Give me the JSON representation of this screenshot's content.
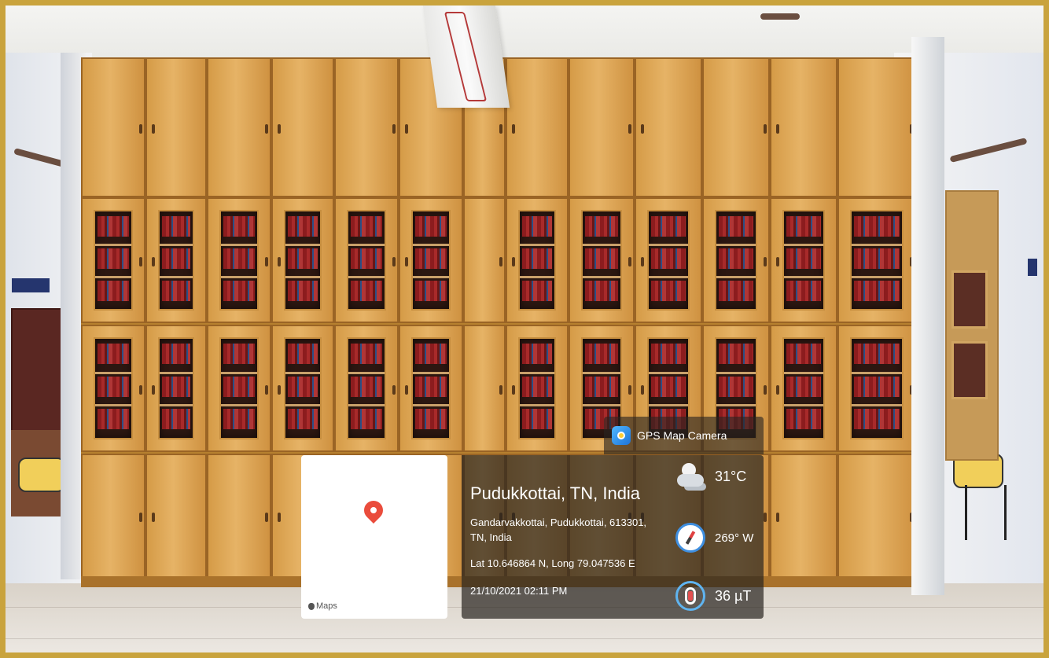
{
  "overlay": {
    "app_name": "GPS Map Camera",
    "map_label": "Maps",
    "location_title": "Pudukkottai, TN, India",
    "address": "Gandarvakkottai, Pudukkottai, 613301, TN, India",
    "coordinates": "Lat 10.646864 N, Long 79.047536 E",
    "datetime": "21/10/2021 02:11 PM",
    "temperature": "31°C",
    "heading": "269° W",
    "magnetic_field": "36 µT",
    "icons": [
      "app-icon",
      "map-pin-icon",
      "apple-icon",
      "weather-icon",
      "compass-icon",
      "magnet-icon"
    ]
  },
  "colors": {
    "frame": "#c9a33d",
    "pin": "#ea4c3c",
    "overlay_bg": "#28241f"
  }
}
